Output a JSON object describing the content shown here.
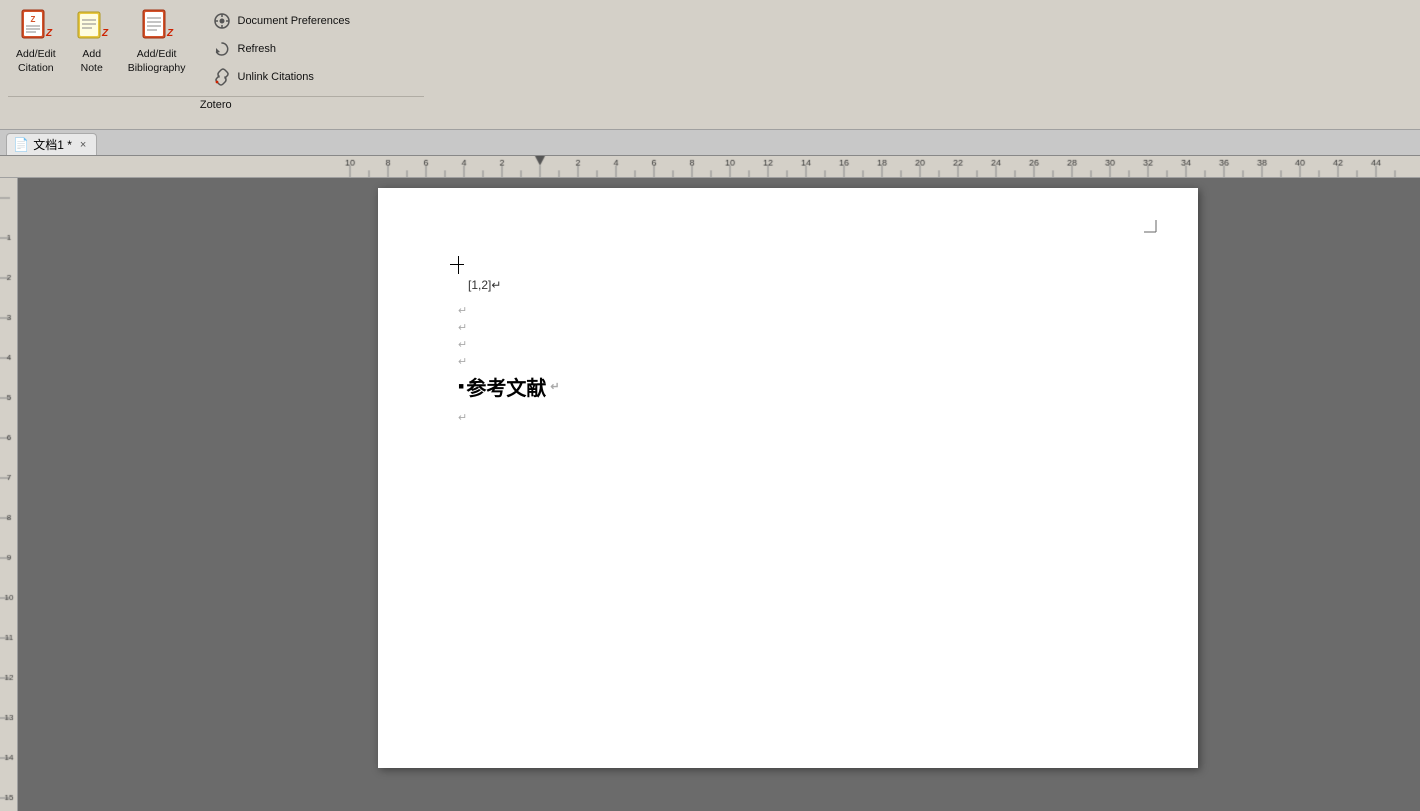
{
  "toolbar": {
    "groups": {
      "zotero": {
        "label": "Zotero",
        "big_buttons": [
          {
            "id": "add-edit-citation",
            "label": "Add/Edit\nCitation",
            "icon": "📄"
          },
          {
            "id": "add-note",
            "label": "Add\nNote",
            "icon": "📋"
          },
          {
            "id": "add-edit-bibliography",
            "label": "Add/Edit\nBibliography",
            "icon": "📄"
          }
        ],
        "small_buttons": [
          {
            "id": "document-preferences",
            "label": "Document Preferences",
            "icon": "⚙"
          },
          {
            "id": "refresh",
            "label": "Refresh",
            "icon": "🔄"
          },
          {
            "id": "unlink-citations",
            "label": "Unlink Citations",
            "icon": "🔗"
          }
        ]
      }
    }
  },
  "tab": {
    "label": "文档1 *",
    "icon": "📄",
    "close": "×"
  },
  "document": {
    "citation": "[1,2]↵",
    "paragraph_marks": [
      "↵",
      "↵",
      "↵",
      "↵"
    ],
    "section_heading": "参考文献",
    "heading_mark": "↵",
    "post_heading_mark": "↵"
  },
  "ruler": {
    "ticks": [
      -8,
      -6,
      -4,
      -2,
      0,
      2,
      4,
      6,
      8,
      10,
      12,
      14,
      16,
      18,
      20,
      22,
      24,
      26,
      28,
      30,
      32,
      34,
      36,
      38,
      40
    ]
  }
}
